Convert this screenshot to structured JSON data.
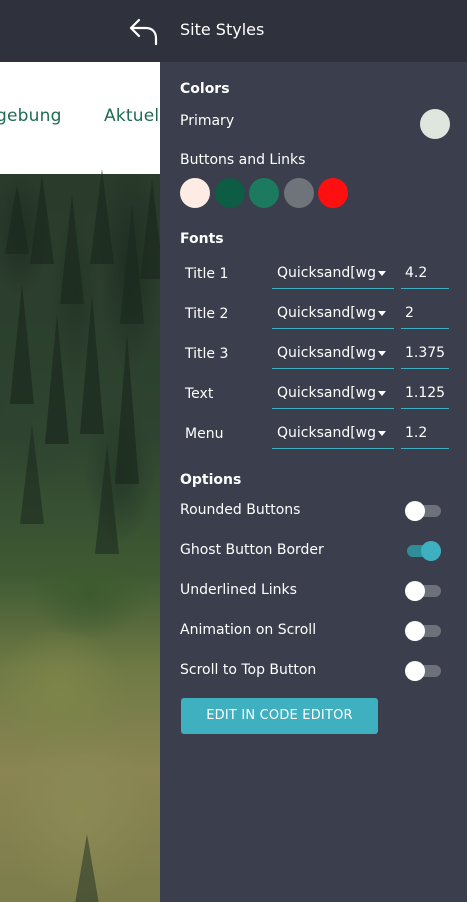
{
  "preview": {
    "nav_links": [
      "gebung",
      "Aktuel"
    ]
  },
  "panel": {
    "title": "Site Styles",
    "colors": {
      "heading": "Colors",
      "primary_label": "Primary",
      "primary_color": "#dfe6dd",
      "buttons_links_label": "Buttons and Links",
      "swatches": [
        "#fcece4",
        "#0d5c44",
        "#1c7a5e",
        "#6e7479",
        "#ff0f0f"
      ]
    },
    "fonts": {
      "heading": "Fonts",
      "rows": [
        {
          "label": "Title 1",
          "family": "Quicksand[wght]",
          "size": "4.2"
        },
        {
          "label": "Title 2",
          "family": "Quicksand[wght]",
          "size": "2"
        },
        {
          "label": "Title 3",
          "family": "Quicksand[wght]",
          "size": "1.375"
        },
        {
          "label": "Text",
          "family": "Quicksand[wght]",
          "size": "1.125"
        },
        {
          "label": "Menu",
          "family": "Quicksand[wght]",
          "size": "1.2"
        }
      ]
    },
    "options": {
      "heading": "Options",
      "items": [
        {
          "label": "Rounded Buttons",
          "on": false
        },
        {
          "label": "Ghost Button Border",
          "on": true
        },
        {
          "label": "Underlined Links",
          "on": false
        },
        {
          "label": "Animation on Scroll",
          "on": false
        },
        {
          "label": "Scroll to Top Button",
          "on": false
        }
      ]
    },
    "code_button_label": "EDIT IN CODE EDITOR",
    "accent_color": "#3fb0c0"
  }
}
